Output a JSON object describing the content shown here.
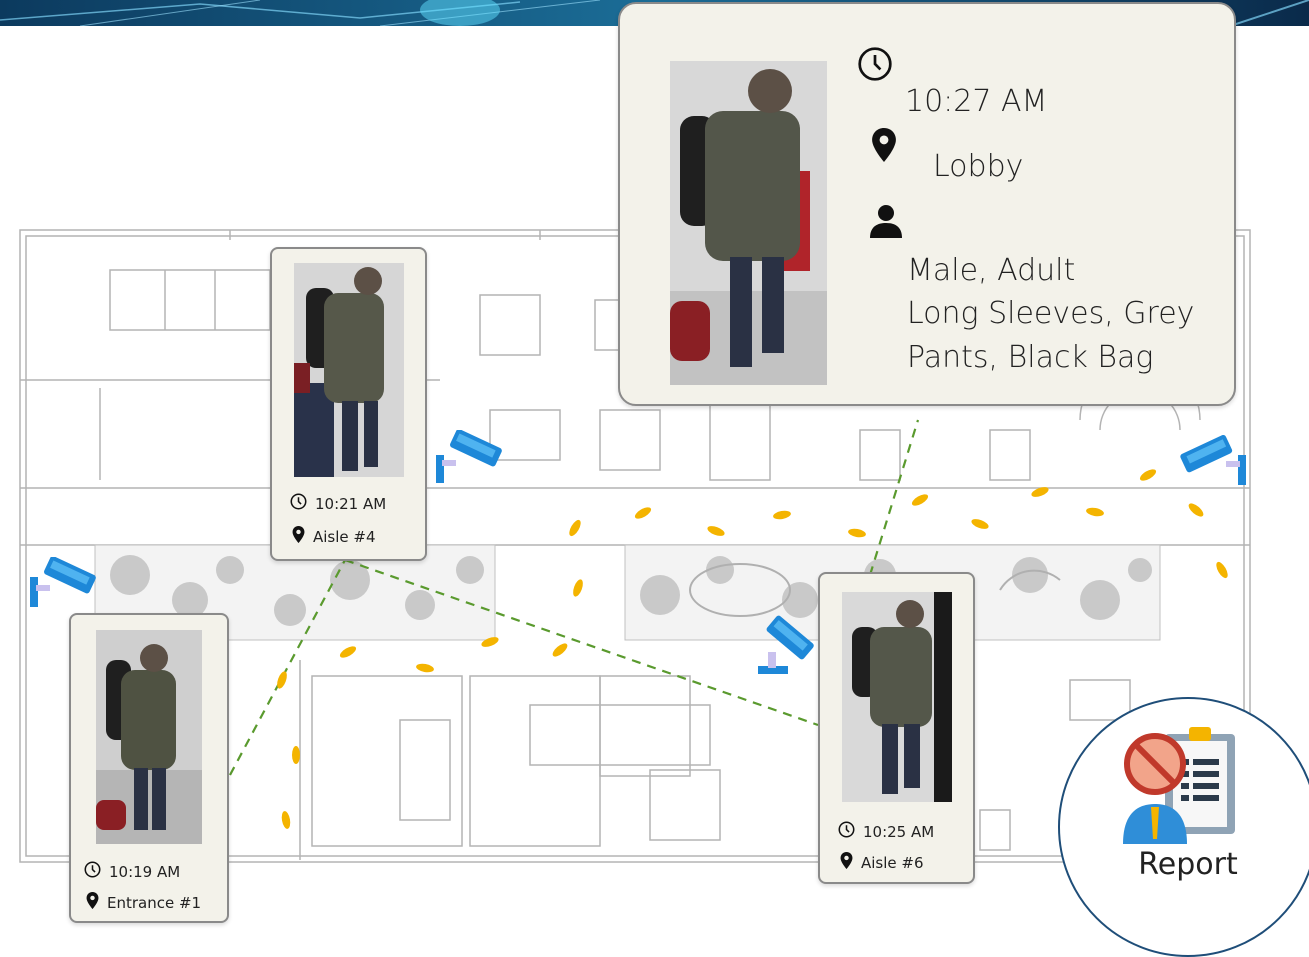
{
  "sightings": [
    {
      "time": "10:19 AM",
      "location": "Entrance #1"
    },
    {
      "time": "10:21 AM",
      "location": "Aisle #4"
    },
    {
      "time": "10:25 AM",
      "location": "Aisle #6"
    }
  ],
  "detail": {
    "time": "10:27 AM",
    "location": "Lobby",
    "attributes": [
      "Male, Adult",
      "Long Sleeves, Grey",
      "Pants, Black Bag"
    ]
  },
  "report": {
    "label": "Report"
  },
  "icons": {
    "time": "clock-icon",
    "location": "map-pin-icon",
    "person": "person-icon",
    "camera": "security-camera-icon",
    "footstep": "footprint-icon",
    "report": "report-icon"
  },
  "colors": {
    "path_dashes": "#5a9a2e",
    "footprints": "#f4b400",
    "camera_body": "#1e88d8",
    "card_bg": "#f3f2ea",
    "report_ring": "#1f4e79"
  }
}
